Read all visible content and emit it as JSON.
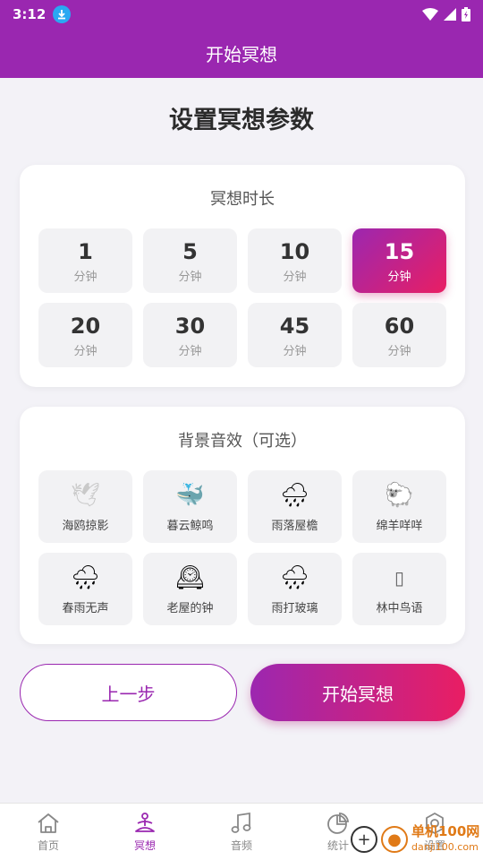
{
  "status_bar": {
    "time": "3:12",
    "download_icon": "download-icon",
    "icons": [
      "wifi-icon",
      "signal-icon",
      "battery-icon"
    ]
  },
  "app_bar": {
    "title": "开始冥想"
  },
  "page": {
    "title": "设置冥想参数"
  },
  "duration": {
    "title": "冥想时长",
    "unit": "分钟",
    "options": [
      "1",
      "5",
      "10",
      "15",
      "20",
      "30",
      "45",
      "60"
    ],
    "selected": "15"
  },
  "sounds": {
    "title": "背景音效（可选）",
    "items": [
      {
        "label": "海鸥掠影",
        "icon": "🕊"
      },
      {
        "label": "暮云鲸鸣",
        "icon": "🐳"
      },
      {
        "label": "雨落屋檐",
        "icon": "🌧"
      },
      {
        "label": "绵羊咩咩",
        "icon": "🐑"
      },
      {
        "label": "春雨无声",
        "icon": "🌧"
      },
      {
        "label": "老屋的钟",
        "icon": "🕰"
      },
      {
        "label": "雨打玻璃",
        "icon": "🌧"
      },
      {
        "label": "林中鸟语",
        "icon": "▯"
      }
    ]
  },
  "actions": {
    "prev_label": "上一步",
    "start_label": "开始冥想"
  },
  "bottom_nav": {
    "items": [
      {
        "label": "首页",
        "icon": "home-icon"
      },
      {
        "label": "冥想",
        "icon": "meditation-icon"
      },
      {
        "label": "音频",
        "icon": "music-note-icon"
      },
      {
        "label": "统计",
        "icon": "pie-chart-icon"
      },
      {
        "label": "设置",
        "icon": "settings-icon"
      }
    ],
    "active": "冥想"
  },
  "colors": {
    "primary": "#9a27b0",
    "accent": "#e91e63",
    "background": "#f3f2f7"
  },
  "watermark": {
    "cn": "单机100网",
    "en": "danji100.com"
  }
}
